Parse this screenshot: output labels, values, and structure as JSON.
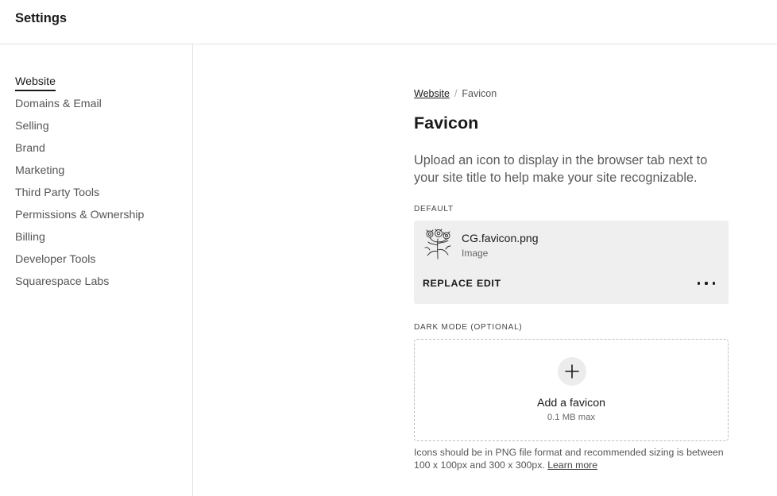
{
  "header": {
    "title": "Settings"
  },
  "sidebar": {
    "items": [
      {
        "label": "Website",
        "active": true
      },
      {
        "label": "Domains & Email"
      },
      {
        "label": "Selling"
      },
      {
        "label": "Brand"
      },
      {
        "label": "Marketing"
      },
      {
        "label": "Third Party Tools"
      },
      {
        "label": "Permissions & Ownership"
      },
      {
        "label": "Billing"
      },
      {
        "label": "Developer Tools"
      },
      {
        "label": "Squarespace Labs"
      }
    ]
  },
  "breadcrumb": {
    "parent": "Website",
    "separator": "/",
    "current": "Favicon"
  },
  "page": {
    "title": "Favicon",
    "description": "Upload an icon to display in the browser tab next to your site title to help make your site recognizable."
  },
  "default_section": {
    "label": "DEFAULT",
    "file_name": "CG.favicon.png",
    "file_type": "Image",
    "thumbnail_icon": "flower-sketch-icon",
    "replace_label": "REPLACE",
    "edit_label": "EDIT",
    "more_icon": "more-horizontal-icon"
  },
  "dark_mode_section": {
    "label": "DARK MODE (OPTIONAL)",
    "add_icon": "plus-icon",
    "add_label": "Add a favicon",
    "size_limit": "0.1 MB max"
  },
  "help": {
    "text": "Icons should be in PNG file format and recommended sizing is between 100 x 100px and 300 x 300px.",
    "link_label": "Learn more"
  },
  "colors": {
    "card_background": "#efefef",
    "border": "#e3e3e3",
    "text_primary": "#1a1a1a",
    "text_secondary": "#555555"
  }
}
